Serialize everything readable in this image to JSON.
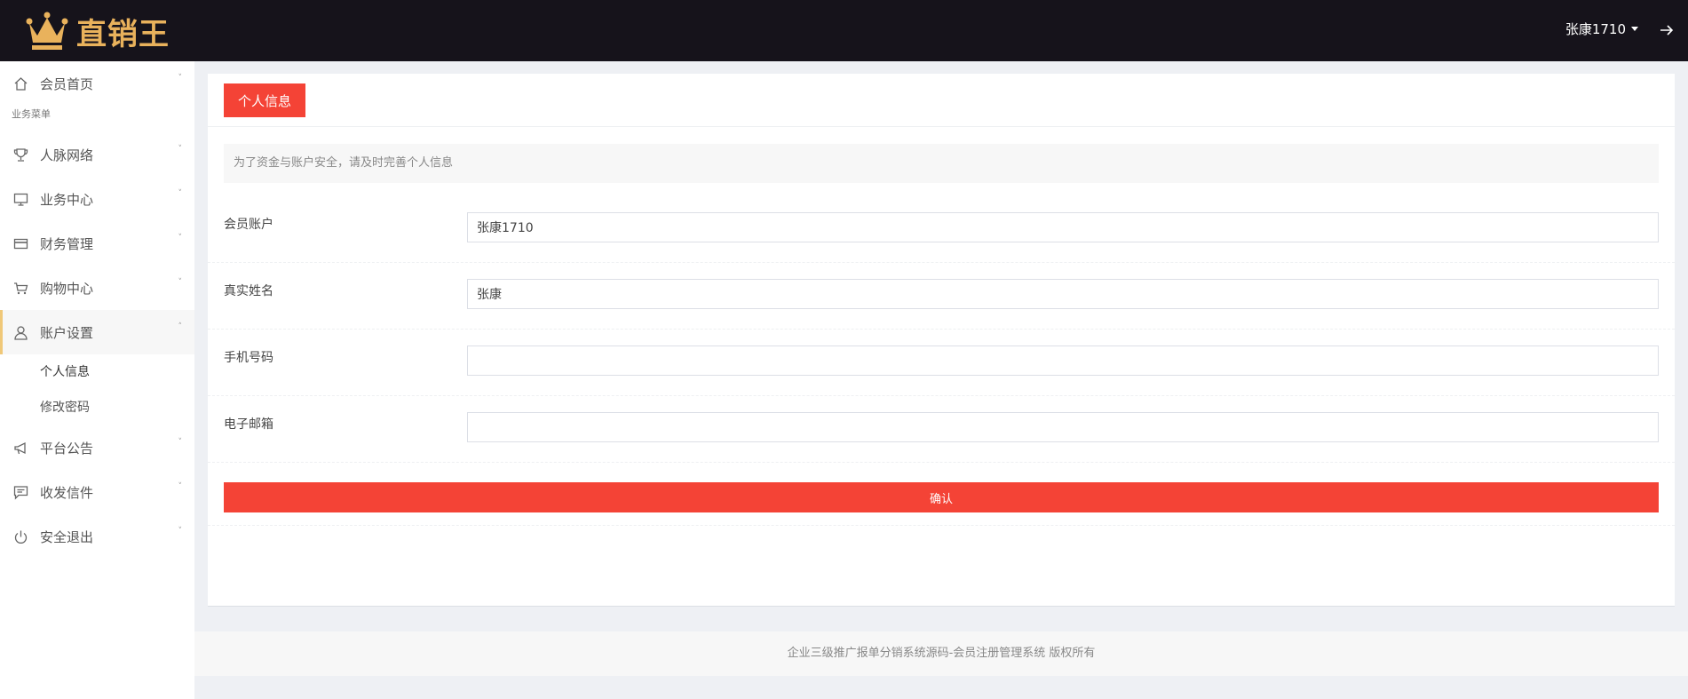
{
  "header": {
    "brand": "直销王",
    "username": "张康1710",
    "logout_icon": "sign-out-icon",
    "logo_color": "#e9b25c",
    "background": "#16131b"
  },
  "sidebar": {
    "home": "会员首页",
    "section_label": "业务菜单",
    "items": [
      {
        "label": "人脉网络",
        "icon": "trophy-icon"
      },
      {
        "label": "业务中心",
        "icon": "monitor-icon"
      },
      {
        "label": "财务管理",
        "icon": "credit-card-icon"
      },
      {
        "label": "购物中心",
        "icon": "cart-icon"
      },
      {
        "label": "账户设置",
        "icon": "user-icon"
      },
      {
        "label": "平台公告",
        "icon": "megaphone-icon"
      },
      {
        "label": "收发信件",
        "icon": "message-icon"
      },
      {
        "label": "安全退出",
        "icon": "power-icon"
      }
    ],
    "sub_items": [
      "个人信息",
      "修改密码"
    ],
    "active_accent": "#f0c878"
  },
  "main": {
    "tab_label": "个人信息",
    "notice": "为了资金与账户安全，请及时完善个人信息",
    "fields": [
      {
        "label": "会员账户",
        "value": "张康1710"
      },
      {
        "label": "真实姓名",
        "value": "张康"
      },
      {
        "label": "手机号码",
        "value": ""
      },
      {
        "label": "电子邮箱",
        "value": ""
      }
    ],
    "confirm_label": "确认",
    "accent": "#f44336"
  },
  "footer": {
    "text": "企业三级推广报单分销系统源码-会员注册管理系统 版权所有"
  }
}
